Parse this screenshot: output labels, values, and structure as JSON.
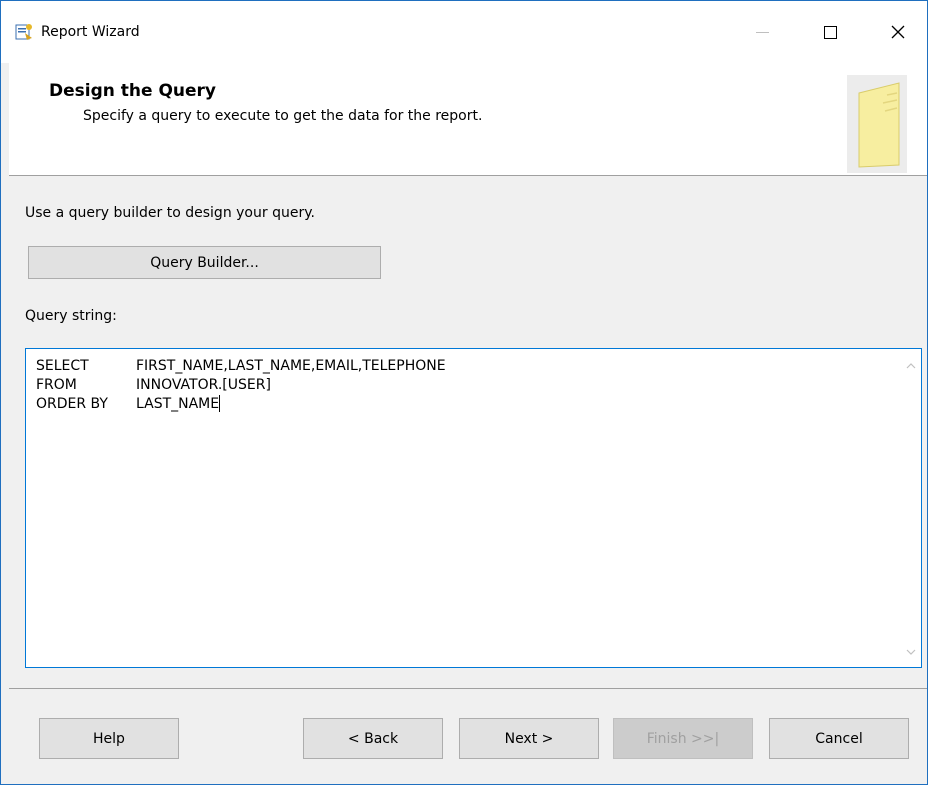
{
  "window": {
    "title": "Report Wizard",
    "controls": {
      "minimize": "—",
      "maximize": "☐",
      "close": "✕"
    }
  },
  "header": {
    "title": "Design the Query",
    "subtitle": "Specify a query to execute to get the data for the report."
  },
  "main": {
    "instruction": "Use a query builder to design your query.",
    "query_builder_label": "Query Builder...",
    "query_string_label": "Query string:",
    "query_lines": [
      {
        "keyword": "SELECT",
        "text": "FIRST_NAME,LAST_NAME,EMAIL,TELEPHONE"
      },
      {
        "keyword": "FROM",
        "text": "INNOVATOR.[USER]"
      },
      {
        "keyword": "ORDER BY",
        "text": "LAST_NAME"
      }
    ]
  },
  "footer": {
    "help_label": "Help",
    "back_label": "< Back",
    "next_label": "Next >",
    "finish_label": "Finish >>|",
    "cancel_label": "Cancel"
  },
  "icons": {
    "app": "report-wizard-icon",
    "header": "note-page-icon",
    "scroll_up": "chevron-up-icon",
    "scroll_down": "chevron-down-icon"
  },
  "colors": {
    "accent": "#0078d7",
    "window_border": "#1f6fbf"
  }
}
